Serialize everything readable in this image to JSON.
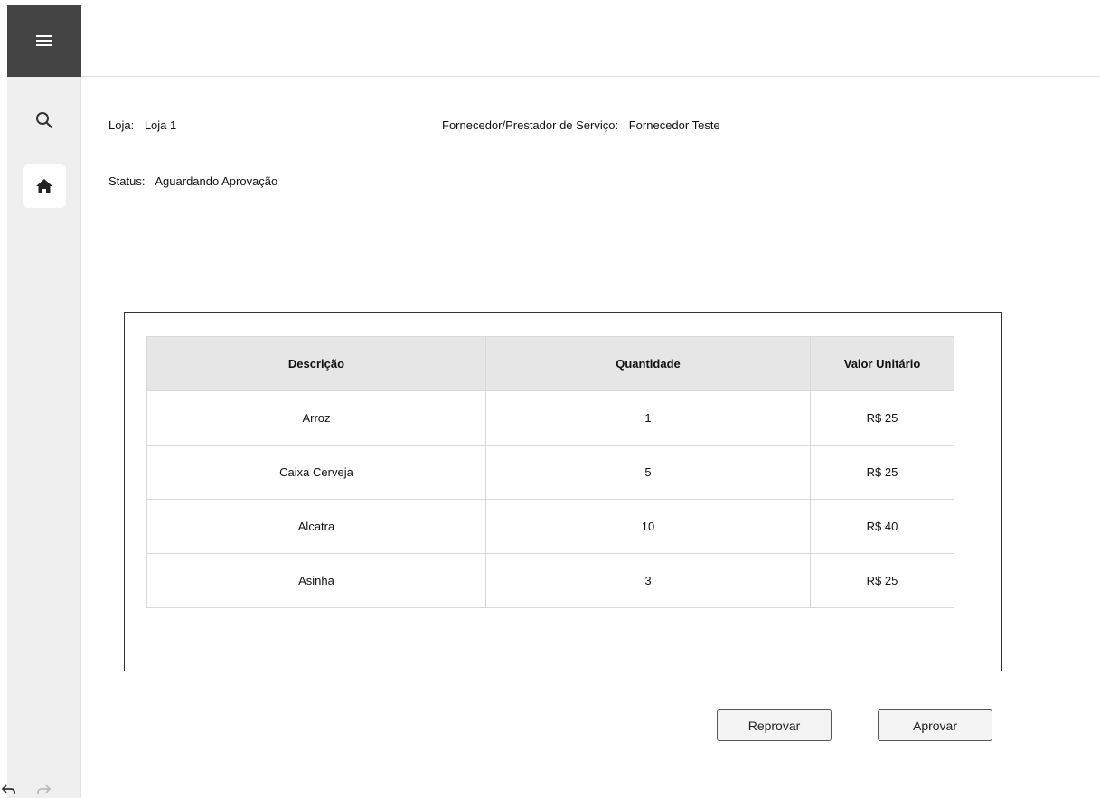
{
  "sidebar": {
    "menu_icon": "hamburger-menu-icon",
    "items": [
      {
        "icon": "search-icon"
      },
      {
        "icon": "home-icon",
        "active": true
      }
    ]
  },
  "info": {
    "loja_label": "Loja:",
    "loja_value": "Loja 1",
    "fornecedor_label": "Fornecedor/Prestador de Serviço:",
    "fornecedor_value": "Fornecedor Teste",
    "status_label": "Status:",
    "status_value": "Aguardando Aprovação"
  },
  "table": {
    "headers": [
      "Descrição",
      "Quantidade",
      "Valor Unitário"
    ],
    "rows": [
      [
        "Arroz",
        "1",
        "R$ 25"
      ],
      [
        "Caixa Cerveja",
        "5",
        "R$ 25"
      ],
      [
        "Alcatra",
        "10",
        "R$ 40"
      ],
      [
        "Asinha",
        "3",
        "R$ 25"
      ]
    ]
  },
  "actions": {
    "reprovar_label": "Reprovar",
    "aprovar_label": "Aprovar"
  },
  "colors": {
    "menu_bg": "#444444",
    "sidebar_bg": "#efefef",
    "header_bg": "#e6e6e6"
  }
}
